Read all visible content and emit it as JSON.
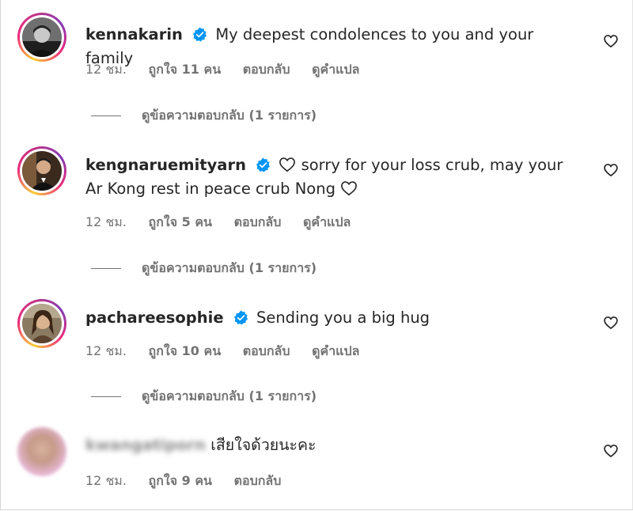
{
  "comments": [
    {
      "username": "kennakarin",
      "verified": true,
      "text": "My deepest condolences to you and your family",
      "time": "12 ชม.",
      "likes": "ถูกใจ 11 คน",
      "reply": "ตอบกลับ",
      "translate": "ดูคำแปล",
      "view_replies": "ดูข้อความตอบกลับ (1 รายการ)"
    },
    {
      "username": "kengnaruemityarn",
      "verified": true,
      "text_part1": "sorry for your loss crub, may your Ar",
      "text_part2": "Kong rest in peace crub Nong",
      "time": "12 ชม.",
      "likes": "ถูกใจ 5 คน",
      "reply": "ตอบกลับ",
      "translate": "ดูคำแปล",
      "view_replies": "ดูข้อความตอบกลับ (1 รายการ)"
    },
    {
      "username": "pachareesophie",
      "verified": true,
      "text": "Sending you a big hug",
      "time": "12 ชม.",
      "likes": "ถูกใจ 10 คน",
      "reply": "ตอบกลับ",
      "translate": "ดูคำแปล",
      "view_replies": "ดูข้อความตอบกลับ (1 รายการ)"
    },
    {
      "username": "kwangatiporn",
      "verified": false,
      "text": "เสียใจด้วยนะคะ",
      "time": "12 ชม.",
      "likes": "ถูกใจ 9 คน",
      "reply": "ตอบกลับ"
    }
  ],
  "icons": {
    "verified": "verified-badge-icon",
    "like": "heart-outline-icon",
    "inline_emoji": "heart-emoji-icon"
  },
  "colors": {
    "verified_blue": "#0095f6",
    "text": "#262626",
    "secondary": "#737373"
  }
}
